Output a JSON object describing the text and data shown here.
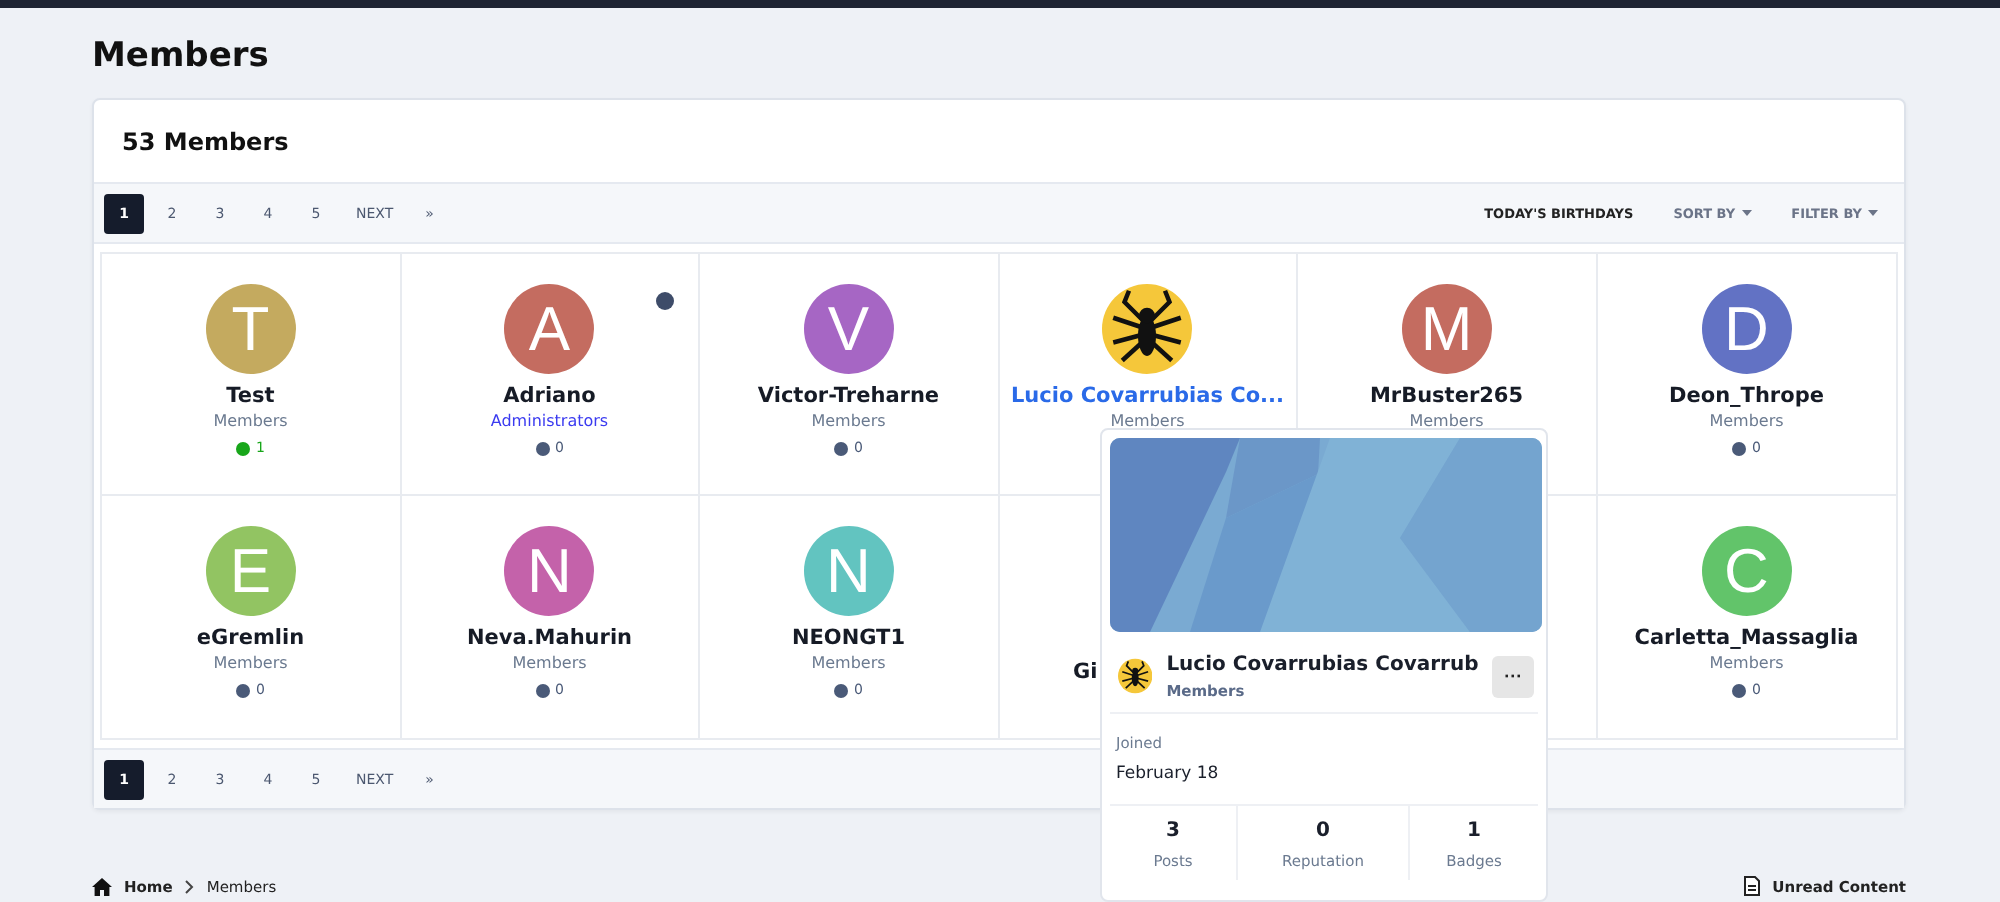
{
  "page_title": "Members",
  "card_title": "53 Members",
  "pagination_top": {
    "pages": [
      {
        "label": "1",
        "selected": true
      },
      {
        "label": "2",
        "selected": false
      },
      {
        "label": "3",
        "selected": false
      },
      {
        "label": "4",
        "selected": false
      },
      {
        "label": "5",
        "selected": false
      }
    ],
    "next": "NEXT",
    "last": "»"
  },
  "toolbar": {
    "birthdays": "TODAY'S BIRTHDAYS",
    "sort": "SORT BY",
    "filter": "FILTER BY"
  },
  "members": [
    {
      "kind": "letter",
      "initial": "T",
      "color": "#c4aa5f",
      "name": "Test",
      "group": "Members",
      "admin": false,
      "reputation": "1",
      "positive": true,
      "online": false,
      "highlighted": false
    },
    {
      "kind": "letter",
      "initial": "A",
      "color": "#c46c60",
      "name": "Adriano",
      "group": "Administrators",
      "admin": true,
      "reputation": "0",
      "positive": false,
      "online": true,
      "highlighted": false
    },
    {
      "kind": "letter",
      "initial": "V",
      "color": "#a666c4",
      "name": "Victor-Treharne",
      "group": "Members",
      "admin": false,
      "reputation": "0",
      "positive": false,
      "online": false,
      "highlighted": false
    },
    {
      "name": "Lucio Covarrubias Co...",
      "group": "Members",
      "admin": false,
      "online": false,
      "highlighted": true
    },
    {
      "kind": "letter",
      "initial": "M",
      "color": "#c46c60",
      "name": "MrBuster265",
      "group": "Members",
      "admin": false,
      "online": false,
      "highlighted": false
    },
    {
      "kind": "letter",
      "initial": "D",
      "color": "#6272c4",
      "name": "Deon_Thrope",
      "group": "Members",
      "admin": false,
      "reputation": "0",
      "positive": false,
      "online": false,
      "highlighted": false
    },
    {
      "kind": "letter",
      "initial": "E",
      "color": "#92c462",
      "name": "eGremlin",
      "group": "Members",
      "admin": false,
      "reputation": "0",
      "positive": false,
      "online": false,
      "highlighted": false
    },
    {
      "kind": "letter",
      "initial": "N",
      "color": "#c462aa",
      "name": "Neva.Mahurin",
      "group": "Members",
      "admin": false,
      "reputation": "0",
      "positive": false,
      "online": false,
      "highlighted": false
    },
    {
      "kind": "letter",
      "initial": "N",
      "color": "#62c4c0",
      "name": "NEONGT1",
      "group": "Members",
      "admin": false,
      "reputation": "0",
      "positive": false,
      "online": false,
      "highlighted": false
    },
    {
      "kind": "covered",
      "name": "Gi"
    },
    {
      "kind": "hidden"
    },
    {
      "kind": "letter",
      "initial": "C",
      "color": "#62c46a",
      "name": "Carletta_Massaglia",
      "group": "Members",
      "admin": false,
      "reputation": "0",
      "positive": false,
      "online": false,
      "highlighted": false
    }
  ],
  "pagination_bottom": {
    "pages": [
      {
        "label": "1",
        "selected": true
      },
      {
        "label": "2",
        "selected": false
      },
      {
        "label": "3",
        "selected": false
      },
      {
        "label": "4",
        "selected": false
      },
      {
        "label": "5",
        "selected": false
      }
    ],
    "next": "NEXT",
    "last": "»"
  },
  "breadcrumb": [
    "Home",
    "Members"
  ],
  "footer_link": "Unread Content",
  "hover_card": {
    "name": "Lucio Covarrubias Covarrub",
    "group": "Members",
    "menu": "···",
    "joined_label": "Joined",
    "joined": "February 18",
    "stats": [
      {
        "value": "3",
        "label": "Posts"
      },
      {
        "value": "0",
        "label": "Reputation"
      },
      {
        "value": "1",
        "label": "Badges"
      }
    ]
  }
}
